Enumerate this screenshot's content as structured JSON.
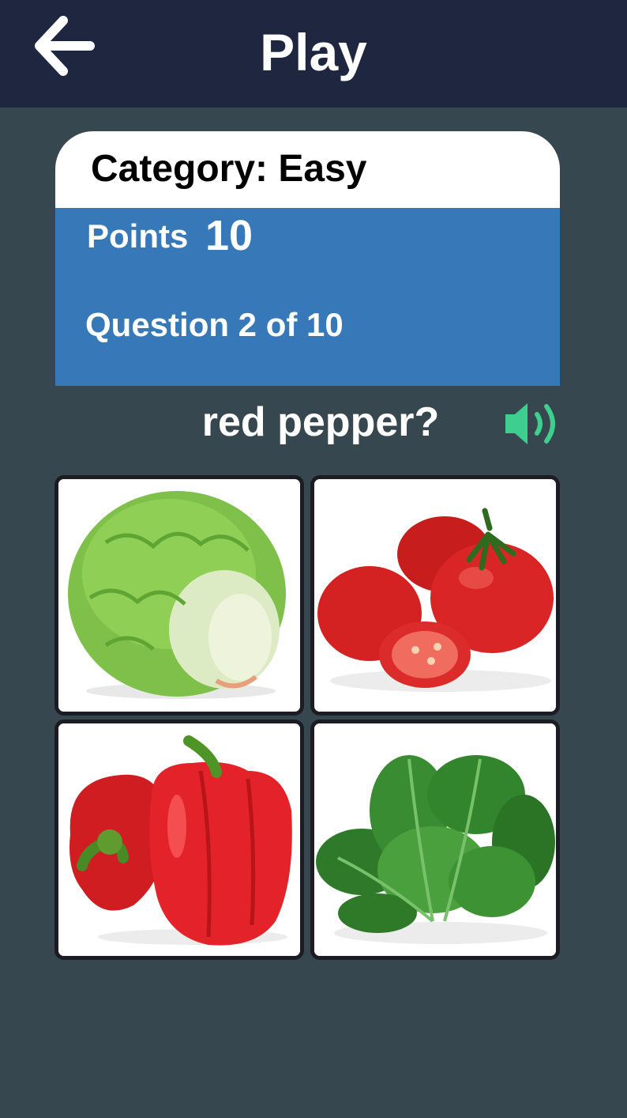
{
  "header": {
    "title": "Play",
    "back_icon": "arrow-left-icon"
  },
  "card": {
    "category": "Category: Easy",
    "points_label": "Points",
    "points_value": "10",
    "question_count": "Question 2 of 10"
  },
  "question": {
    "prompt": "red pepper?",
    "audio_icon": "speaker-icon"
  },
  "answers": [
    {
      "image": "lettuce"
    },
    {
      "image": "tomatoes"
    },
    {
      "image": "red-peppers"
    },
    {
      "image": "spinach"
    }
  ],
  "colors": {
    "topbar": "#1f2640",
    "background": "#37474f",
    "card_header": "#ffffff",
    "card_body": "#3778b8",
    "speaker": "#3ecf8e",
    "tile_border": "#1c1c22"
  }
}
